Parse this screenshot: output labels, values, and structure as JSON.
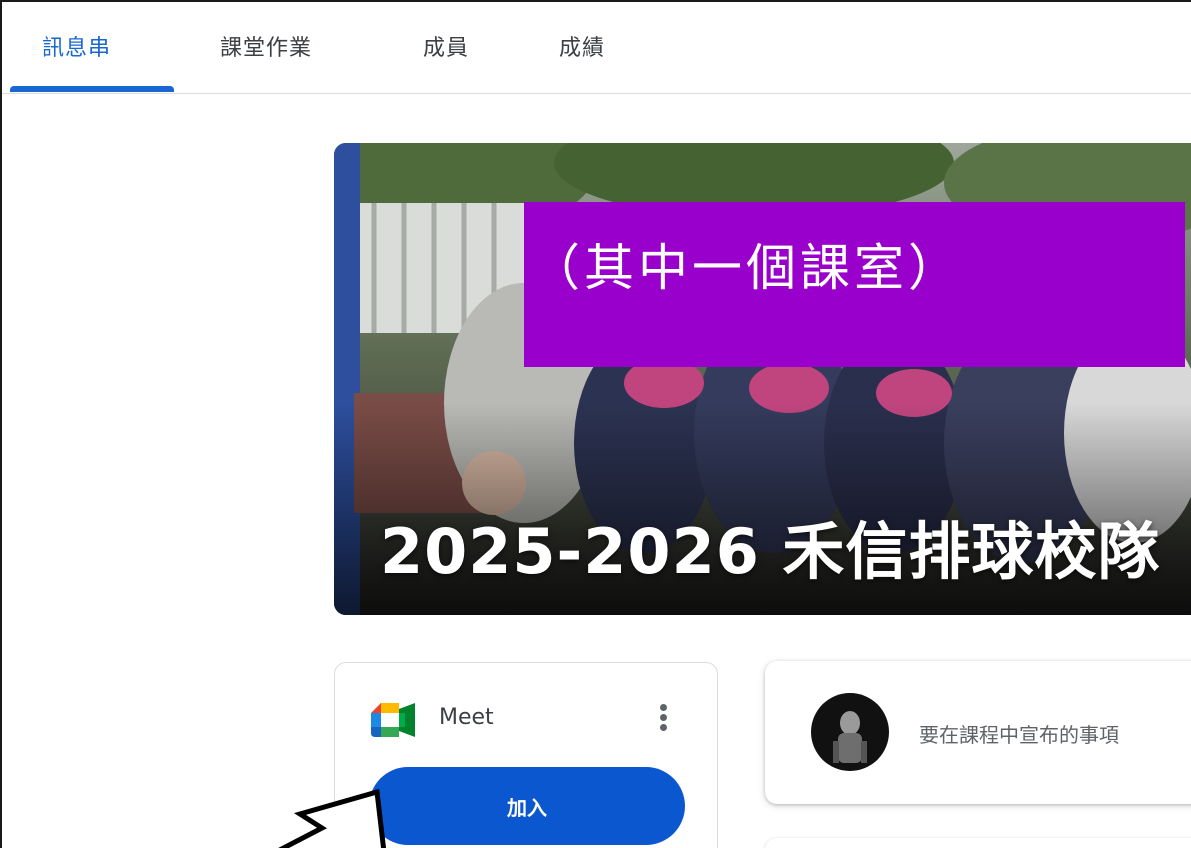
{
  "tabs": [
    {
      "label": "訊息串",
      "active": true
    },
    {
      "label": "課堂作業"
    },
    {
      "label": "成員"
    },
    {
      "label": "成績"
    }
  ],
  "banner": {
    "title": "2025-2026 禾信排球校隊",
    "overlay_text": "（其中一個課室）",
    "overlay_color": "#9900cc"
  },
  "meet": {
    "label": "Meet",
    "join_label": "加入",
    "icon": "google-meet-icon",
    "accent": "#0b57d0"
  },
  "announcement": {
    "placeholder": "要在課程中宣布的事項",
    "avatar": "user-avatar"
  },
  "colors": {
    "active_tab": "#1967d2",
    "text": "#3c4043"
  }
}
